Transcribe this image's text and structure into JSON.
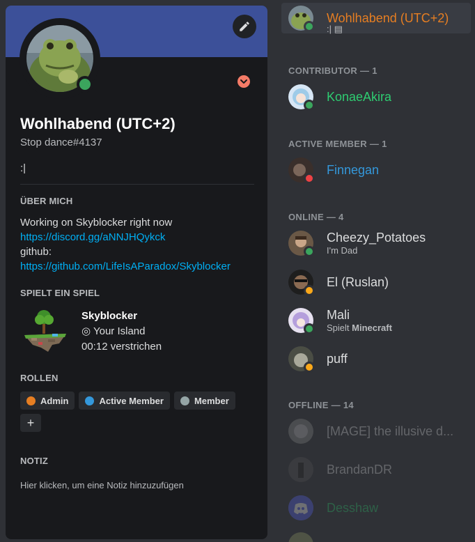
{
  "colors": {
    "banner": "#3c5099",
    "online": "#3ba55d",
    "dnd": "#ed4245",
    "idle": "#faa81a",
    "link": "#00aff4",
    "nitro_badge": "#f47b67"
  },
  "profile": {
    "display_name": "Wohlhabend (UTC+2)",
    "username": "Stop dance#4137",
    "custom_status": ":|",
    "about_title": "ÜBER MICH",
    "about": {
      "line1": "Working on Skyblocker right now",
      "link1": "https://discord.gg/aNNJHQykck",
      "line2": "github:",
      "link2": "https://github.com/LifeIsAParadox/Skyblocker"
    },
    "game_title": "SPIELT EIN SPIEL",
    "game": {
      "name": "Skyblocker",
      "state": "◎ Your Island",
      "elapsed": "00:12 verstrichen"
    },
    "roles_title": "ROLLEN",
    "roles": [
      {
        "label": "Admin",
        "color": "#e67e22"
      },
      {
        "label": "Active Member",
        "color": "#3498db"
      },
      {
        "label": "Member",
        "color": "#95a5a6"
      }
    ],
    "add_role": "+",
    "note_title": "NOTIZ",
    "note_placeholder": "Hier klicken, um eine Notiz hinzuzufügen",
    "icons": {
      "edit": "pencil-icon",
      "status": "online-status-icon",
      "nitro": "nitro-boost-icon"
    }
  },
  "member_list": {
    "top_member": {
      "name": "Wohlhabend (UTC+2)",
      "sub": ":|",
      "status": "online",
      "name_color": "#e67e22"
    },
    "groups": [
      {
        "title": "CONTRIBUTOR — 1"
      },
      {
        "title": "ACTIVE MEMBER — 1"
      },
      {
        "title": "ONLINE — 4"
      },
      {
        "title": "OFFLINE — 14"
      }
    ],
    "contributor": {
      "name": "KonaeAkira",
      "status": "online",
      "name_color": "#2ecc71"
    },
    "active": {
      "name": "Finnegan",
      "status": "dnd",
      "name_color": "#3498db"
    },
    "online": [
      {
        "name": "Cheezy_Potatoes",
        "sub": "I'm Dad",
        "status": "online",
        "name_color": "#dcddde"
      },
      {
        "name": "El (Ruslan)",
        "sub": "",
        "status": "idle",
        "name_color": "#dcddde"
      },
      {
        "name": "Mali",
        "sub_prefix": "Spielt",
        "sub_game": "Minecraft",
        "status": "online",
        "name_color": "#dcddde"
      },
      {
        "name": "puff",
        "sub": "",
        "status": "idle",
        "name_color": "#dcddde"
      }
    ],
    "offline": [
      {
        "name": "[MAGE] the illusive d...",
        "name_color": "#dcddde"
      },
      {
        "name": "BrandanDR",
        "name_color": "#dcddde"
      },
      {
        "name": "Desshaw",
        "name_color": "#2ecc71"
      }
    ]
  }
}
